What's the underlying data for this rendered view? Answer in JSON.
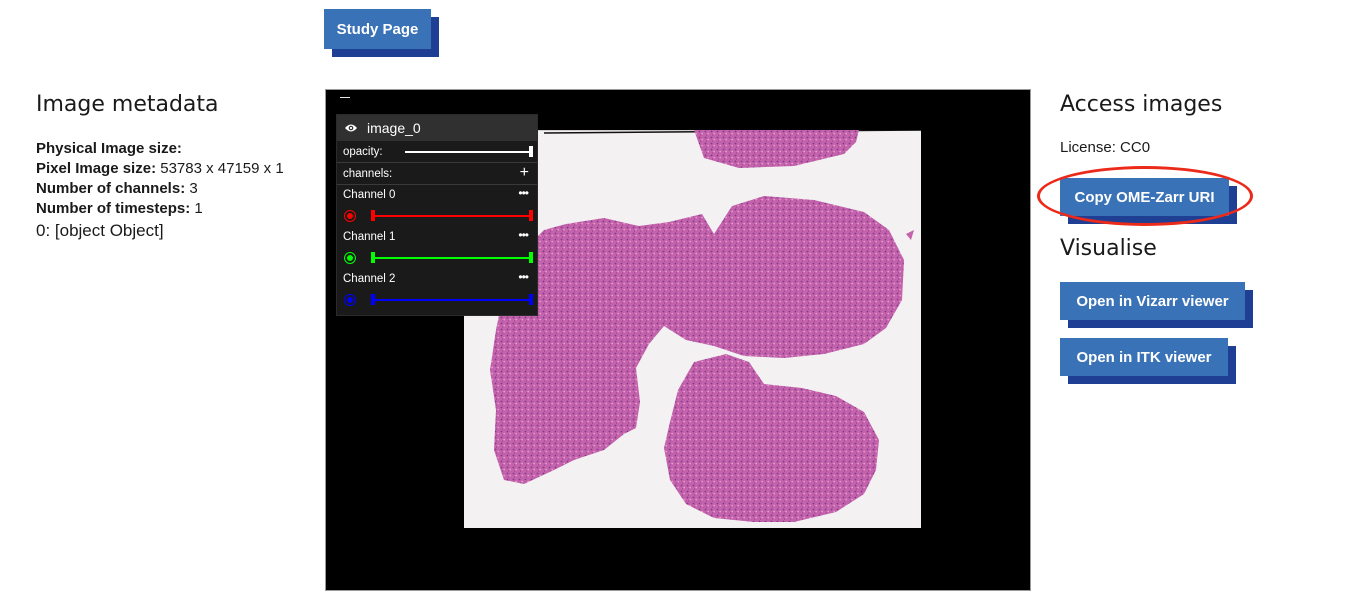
{
  "header": {
    "study_button": "Study Page"
  },
  "metadata": {
    "title": "Image metadata",
    "physical_label": "Physical Image size:",
    "physical_value": "",
    "pixel_label": "Pixel Image size:",
    "pixel_value": " 53783 x 47159 x 1",
    "channels_label": "Number of channels:",
    "channels_value": " 3",
    "timesteps_label": "Number of timesteps:",
    "timesteps_value": " 1",
    "object_line": "0: [object Object]"
  },
  "viewer": {
    "layer_name": "image_0",
    "opacity_label": "opacity:",
    "opacity_value": 1.0,
    "channels_label": "channels:",
    "add_symbol": "+",
    "more_symbol": "•••",
    "channels": [
      {
        "name": "Channel 0",
        "color": "#ff0000"
      },
      {
        "name": "Channel 1",
        "color": "#00ff00"
      },
      {
        "name": "Channel 2",
        "color": "#0000ff"
      }
    ],
    "eye_icon": "eye-icon",
    "collapse_icon": "minus-icon"
  },
  "access": {
    "title": "Access images",
    "license": "License: CC0",
    "copy_button": "Copy OME-Zarr URI"
  },
  "visualise": {
    "title": "Visualise",
    "vizarr_button": "Open in Vizarr viewer",
    "itk_button": "Open in ITK viewer"
  },
  "colors": {
    "button": "#3a72b8",
    "button_shadow": "#1e3f93",
    "highlight": "#ec2a1a",
    "tissue": "#c05aa8"
  }
}
